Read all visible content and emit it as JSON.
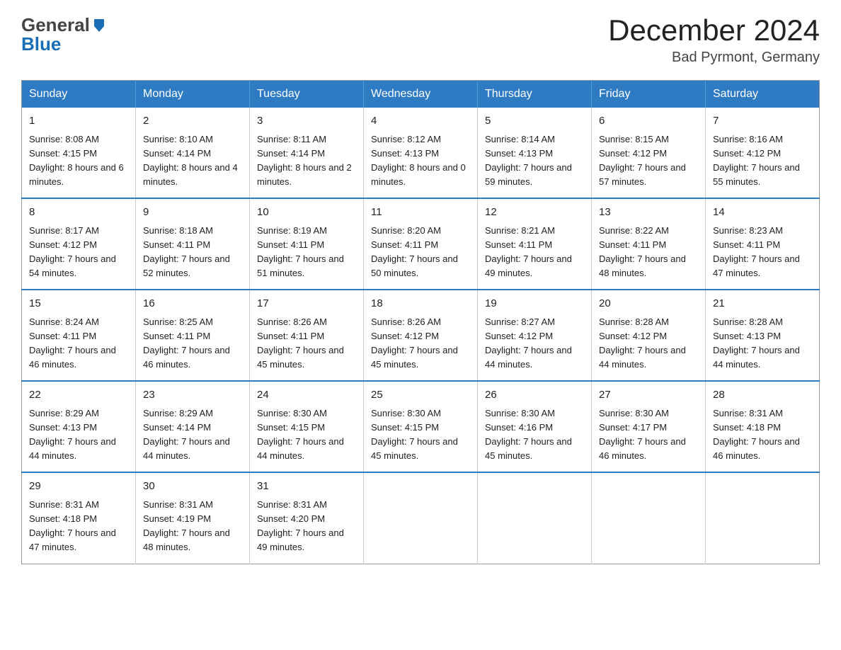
{
  "header": {
    "logo_line1": "General",
    "logo_line2": "Blue",
    "month_year": "December 2024",
    "location": "Bad Pyrmont, Germany"
  },
  "days_of_week": [
    "Sunday",
    "Monday",
    "Tuesday",
    "Wednesday",
    "Thursday",
    "Friday",
    "Saturday"
  ],
  "weeks": [
    [
      {
        "day": "1",
        "sunrise": "8:08 AM",
        "sunset": "4:15 PM",
        "daylight": "8 hours and 6 minutes."
      },
      {
        "day": "2",
        "sunrise": "8:10 AM",
        "sunset": "4:14 PM",
        "daylight": "8 hours and 4 minutes."
      },
      {
        "day": "3",
        "sunrise": "8:11 AM",
        "sunset": "4:14 PM",
        "daylight": "8 hours and 2 minutes."
      },
      {
        "day": "4",
        "sunrise": "8:12 AM",
        "sunset": "4:13 PM",
        "daylight": "8 hours and 0 minutes."
      },
      {
        "day": "5",
        "sunrise": "8:14 AM",
        "sunset": "4:13 PM",
        "daylight": "7 hours and 59 minutes."
      },
      {
        "day": "6",
        "sunrise": "8:15 AM",
        "sunset": "4:12 PM",
        "daylight": "7 hours and 57 minutes."
      },
      {
        "day": "7",
        "sunrise": "8:16 AM",
        "sunset": "4:12 PM",
        "daylight": "7 hours and 55 minutes."
      }
    ],
    [
      {
        "day": "8",
        "sunrise": "8:17 AM",
        "sunset": "4:12 PM",
        "daylight": "7 hours and 54 minutes."
      },
      {
        "day": "9",
        "sunrise": "8:18 AM",
        "sunset": "4:11 PM",
        "daylight": "7 hours and 52 minutes."
      },
      {
        "day": "10",
        "sunrise": "8:19 AM",
        "sunset": "4:11 PM",
        "daylight": "7 hours and 51 minutes."
      },
      {
        "day": "11",
        "sunrise": "8:20 AM",
        "sunset": "4:11 PM",
        "daylight": "7 hours and 50 minutes."
      },
      {
        "day": "12",
        "sunrise": "8:21 AM",
        "sunset": "4:11 PM",
        "daylight": "7 hours and 49 minutes."
      },
      {
        "day": "13",
        "sunrise": "8:22 AM",
        "sunset": "4:11 PM",
        "daylight": "7 hours and 48 minutes."
      },
      {
        "day": "14",
        "sunrise": "8:23 AM",
        "sunset": "4:11 PM",
        "daylight": "7 hours and 47 minutes."
      }
    ],
    [
      {
        "day": "15",
        "sunrise": "8:24 AM",
        "sunset": "4:11 PM",
        "daylight": "7 hours and 46 minutes."
      },
      {
        "day": "16",
        "sunrise": "8:25 AM",
        "sunset": "4:11 PM",
        "daylight": "7 hours and 46 minutes."
      },
      {
        "day": "17",
        "sunrise": "8:26 AM",
        "sunset": "4:11 PM",
        "daylight": "7 hours and 45 minutes."
      },
      {
        "day": "18",
        "sunrise": "8:26 AM",
        "sunset": "4:12 PM",
        "daylight": "7 hours and 45 minutes."
      },
      {
        "day": "19",
        "sunrise": "8:27 AM",
        "sunset": "4:12 PM",
        "daylight": "7 hours and 44 minutes."
      },
      {
        "day": "20",
        "sunrise": "8:28 AM",
        "sunset": "4:12 PM",
        "daylight": "7 hours and 44 minutes."
      },
      {
        "day": "21",
        "sunrise": "8:28 AM",
        "sunset": "4:13 PM",
        "daylight": "7 hours and 44 minutes."
      }
    ],
    [
      {
        "day": "22",
        "sunrise": "8:29 AM",
        "sunset": "4:13 PM",
        "daylight": "7 hours and 44 minutes."
      },
      {
        "day": "23",
        "sunrise": "8:29 AM",
        "sunset": "4:14 PM",
        "daylight": "7 hours and 44 minutes."
      },
      {
        "day": "24",
        "sunrise": "8:30 AM",
        "sunset": "4:15 PM",
        "daylight": "7 hours and 44 minutes."
      },
      {
        "day": "25",
        "sunrise": "8:30 AM",
        "sunset": "4:15 PM",
        "daylight": "7 hours and 45 minutes."
      },
      {
        "day": "26",
        "sunrise": "8:30 AM",
        "sunset": "4:16 PM",
        "daylight": "7 hours and 45 minutes."
      },
      {
        "day": "27",
        "sunrise": "8:30 AM",
        "sunset": "4:17 PM",
        "daylight": "7 hours and 46 minutes."
      },
      {
        "day": "28",
        "sunrise": "8:31 AM",
        "sunset": "4:18 PM",
        "daylight": "7 hours and 46 minutes."
      }
    ],
    [
      {
        "day": "29",
        "sunrise": "8:31 AM",
        "sunset": "4:18 PM",
        "daylight": "7 hours and 47 minutes."
      },
      {
        "day": "30",
        "sunrise": "8:31 AM",
        "sunset": "4:19 PM",
        "daylight": "7 hours and 48 minutes."
      },
      {
        "day": "31",
        "sunrise": "8:31 AM",
        "sunset": "4:20 PM",
        "daylight": "7 hours and 49 minutes."
      },
      null,
      null,
      null,
      null
    ]
  ],
  "labels": {
    "sunrise": "Sunrise:",
    "sunset": "Sunset:",
    "daylight": "Daylight:"
  }
}
